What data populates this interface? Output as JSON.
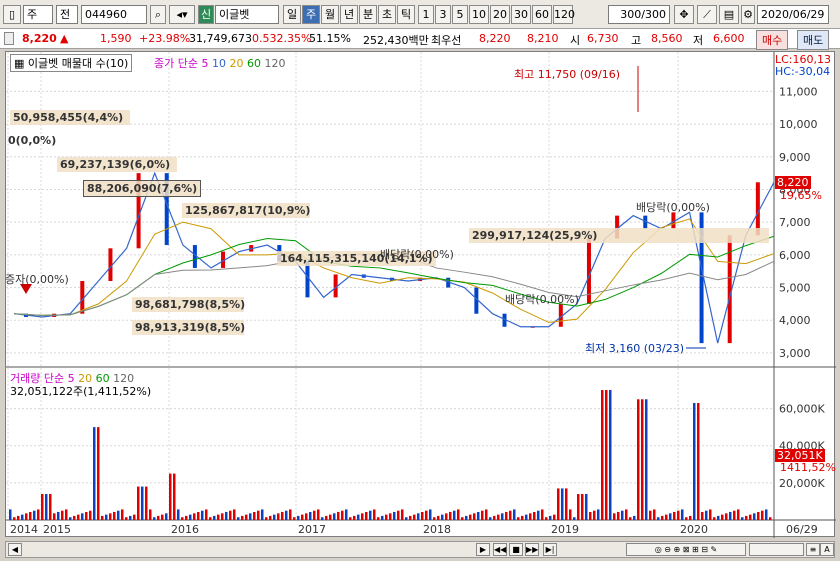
{
  "toolbar": {
    "market": "주",
    "code_kind": "전",
    "code": "044960",
    "name_badge": "신",
    "name": "이글벳",
    "periods": [
      "일",
      "주",
      "월",
      "년",
      "분",
      "초",
      "틱"
    ],
    "active_period": "주",
    "ticks": [
      "1",
      "3",
      "5",
      "10",
      "20",
      "30",
      "60",
      "120"
    ],
    "count": "300/300",
    "date": "2020/06/29"
  },
  "quote": {
    "price": "8,220",
    "up_arrow": "▲",
    "change": "1,590",
    "change_pct": "+23.98%",
    "volume": "31,749,673",
    "turnover": "0.532.35%",
    "ratio": "51.15%",
    "amount": "252,430백만",
    "best_ask_label": "최우선",
    "best_ask": "8,220",
    "best_bid": "8,210",
    "open_label": "시",
    "open": "6,730",
    "high_label": "고",
    "high": "8,560",
    "low_label": "저",
    "low": "6,600",
    "buy": "매수",
    "sell": "매도"
  },
  "price_panel": {
    "title": "이글벳 매물대 수(10)",
    "ma_label": "종가 단순",
    "ma_periods": [
      "5",
      "10",
      "20",
      "60",
      "120"
    ],
    "ma_colors": [
      "#3366cc",
      "#cc9900",
      "#009900",
      "#666666"
    ],
    "lc": "LC:160,13",
    "hc": "HC:-30,04",
    "high_note": "최고 11,750 (09/16)",
    "low_note": "최저 3,160 (03/23)",
    "last_price": "8,220",
    "last_pct": "19,65%",
    "y_ticks": [
      "11,000",
      "10,000",
      "9,000",
      "8,000",
      "7,000",
      "6,000",
      "5,000",
      "4,000",
      "3,000"
    ],
    "volume_profile": [
      "50,958,455(4,4%)",
      "0(0,0%)",
      "69,237,139(6,0%)",
      "88,206,090(7,6%)",
      "125,867,817(10,9%)",
      "299,917,124(25,9%)",
      "164,115,315,140(14,1%)",
      "98,681,798(8,5%)",
      "98,913,319(8,5%)"
    ],
    "events": [
      "증자(0,00%)",
      "배당락(0,00%)",
      "배당락(0,00%)",
      "배당락(0,00%)"
    ]
  },
  "volume_panel": {
    "title": "거래량",
    "ma_label": "단순",
    "ma_periods": [
      "5",
      "20",
      "60",
      "120"
    ],
    "last_label": "32,051,122주(1,411,52%)",
    "last_tag": "32,051K",
    "last_tag_pct": "1411,52%",
    "y_ticks": [
      "60,000K",
      "40,000K",
      "20,000K"
    ]
  },
  "x_axis": [
    "2014",
    "2015",
    "2016",
    "2017",
    "2018",
    "2019",
    "2020",
    "06/29"
  ],
  "chart_data": {
    "type": "line",
    "x": [
      "2014-01",
      "2014-07",
      "2015-01",
      "2015-04",
      "2015-07",
      "2015-09",
      "2015-12",
      "2016-03",
      "2016-06",
      "2016-09",
      "2016-12",
      "2017-03",
      "2017-06",
      "2017-09",
      "2017-12",
      "2018-03",
      "2018-06",
      "2018-09",
      "2018-12",
      "2019-02",
      "2019-04",
      "2019-06",
      "2019-09",
      "2019-11",
      "2020-01",
      "2020-03",
      "2020-05",
      "2020-06"
    ],
    "series": [
      {
        "name": "종가",
        "values": [
          4200,
          4100,
          4200,
          5200,
          6200,
          8500,
          6300,
          5600,
          6100,
          6300,
          5800,
          4700,
          5400,
          5300,
          5200,
          5300,
          5000,
          4200,
          3800,
          3800,
          4500,
          6500,
          7200,
          6800,
          7300,
          3300,
          6600,
          8220
        ]
      }
    ],
    "ylim": [
      3000,
      11750
    ],
    "volume_ylim": [
      0,
      70000
    ]
  }
}
